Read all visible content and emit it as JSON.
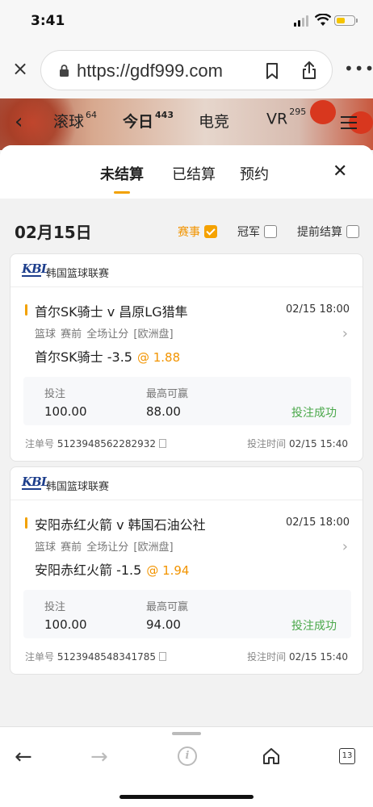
{
  "status_bar": {
    "time": "3:41"
  },
  "browser": {
    "url": "https://gdf999.com",
    "tab_count": "13"
  },
  "header": {
    "tabs": [
      {
        "label": "滚球",
        "count": "64"
      },
      {
        "label": "今日",
        "count": "443"
      },
      {
        "label": "电竞",
        "count": ""
      },
      {
        "label": "VR",
        "count": "295"
      }
    ]
  },
  "sheet": {
    "tabs": [
      "未结算",
      "已结算",
      "预约"
    ],
    "active_tab": "未结算",
    "date": "02月15日",
    "filters": [
      {
        "label": "赛事",
        "checked": true
      },
      {
        "label": "冠军",
        "checked": false
      },
      {
        "label": "提前结算",
        "checked": false
      }
    ]
  },
  "bets": [
    {
      "league": "韩国篮球联赛",
      "match": "首尔SK骑士 v 昌原LG猎隼",
      "match_time": "02/15 18:00",
      "meta": "篮球  赛前  全场让分  [欧洲盘]",
      "pick": "首尔SK骑士 -3.5",
      "odds": "@ 1.88",
      "stake_label": "投注",
      "stake": "100.00",
      "max_win_label": "最高可赢",
      "max_win": "88.00",
      "status": "投注成功",
      "order_label": "注单号",
      "order_no": "5123948562282932",
      "bet_time_label": "投注时间",
      "bet_time": "02/15 15:40"
    },
    {
      "league": "韩国篮球联赛",
      "match": "安阳赤红火箭 v 韩国石油公社",
      "match_time": "02/15 18:00",
      "meta": "篮球  赛前  全场让分  [欧洲盘]",
      "pick": "安阳赤红火箭 -1.5",
      "odds": "@ 1.94",
      "stake_label": "投注",
      "stake": "100.00",
      "max_win_label": "最高可赢",
      "max_win": "94.00",
      "status": "投注成功",
      "order_label": "注单号",
      "order_no": "5123948548341785",
      "bet_time_label": "投注时间",
      "bet_time": "02/15 15:40"
    }
  ],
  "colors": {
    "accent": "#f2a100",
    "success": "#4aa84a",
    "odds": "#f29400"
  }
}
